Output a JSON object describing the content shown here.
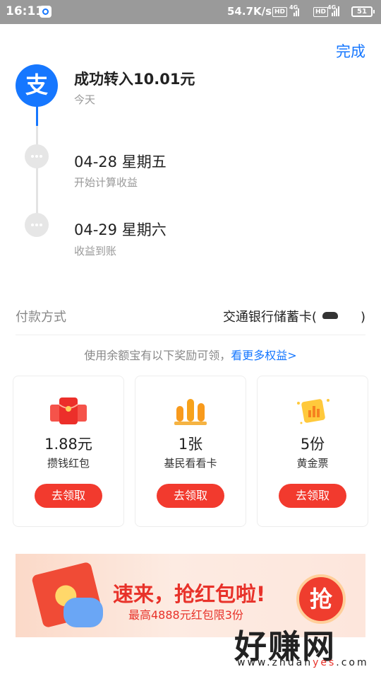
{
  "status_bar": {
    "time": "16:11",
    "speed": "54.7K/s",
    "hd": "HD",
    "network": "4G",
    "battery": "51"
  },
  "header": {
    "done_label": "完成"
  },
  "timeline": {
    "steps": [
      {
        "title": "成功转入10.01元",
        "subtitle": "今天"
      },
      {
        "title": "04-28 星期五",
        "subtitle": "开始计算收益"
      },
      {
        "title": "04-29 星期六",
        "subtitle": "收益到账"
      }
    ]
  },
  "payment": {
    "label": "付款方式",
    "value": "交通银行储蓄卡(",
    "suffix": ")"
  },
  "rewards": {
    "note": "使用余额宝有以下奖励可领，",
    "link": "看更多权益>",
    "cards": [
      {
        "value": "1.88元",
        "label": "攒钱红包",
        "button": "去领取"
      },
      {
        "value": "1张",
        "label": "基民看看卡",
        "button": "去领取"
      },
      {
        "value": "5份",
        "label": "黄金票",
        "button": "去领取"
      }
    ]
  },
  "banner": {
    "title": "速来，抢红包啦!",
    "subtitle": "最高4888元红包限3份",
    "grab_label": "抢"
  },
  "watermark": {
    "text": "好赚网",
    "url_pre": "www.zhuan",
    "url_hl": "yes",
    "url_post": ".com"
  },
  "colors": {
    "accent": "#1677ff",
    "button": "#f23a2e",
    "banner_text": "#e8322a"
  },
  "icons": [
    "alipay-logo-icon",
    "more-dots-icon",
    "red-envelope-icon",
    "chart-bars-icon",
    "gold-ticket-icon"
  ]
}
